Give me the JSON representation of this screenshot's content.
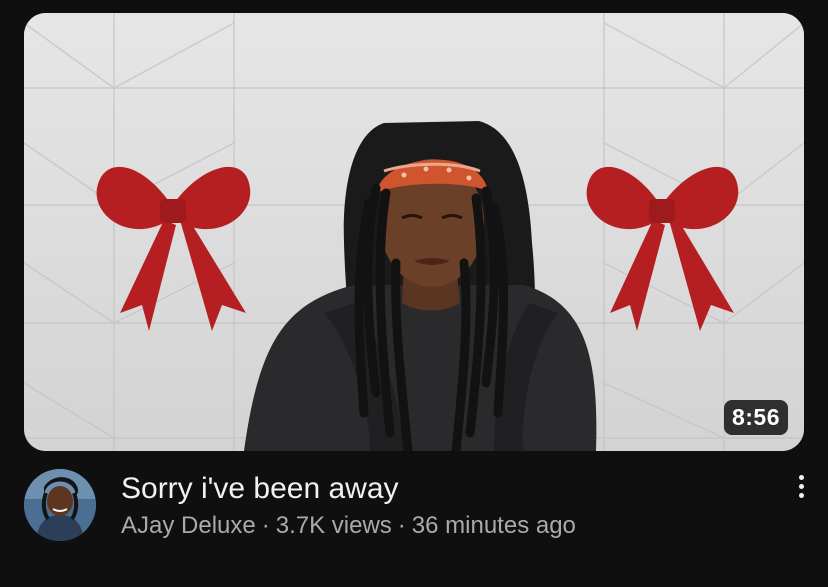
{
  "video": {
    "duration": "8:56",
    "title": "Sorry i've been away",
    "channel": "AJay Deluxe",
    "views": "3.7K views",
    "age": "36 minutes ago",
    "separator": "·"
  },
  "icons": {
    "more": "more-vert-icon",
    "avatar": "channel-avatar"
  },
  "colors": {
    "background": "#0f0f0f",
    "title_text": "#f1f1f1",
    "meta_text": "#aaaaaa",
    "bow_red": "#b51f22"
  }
}
